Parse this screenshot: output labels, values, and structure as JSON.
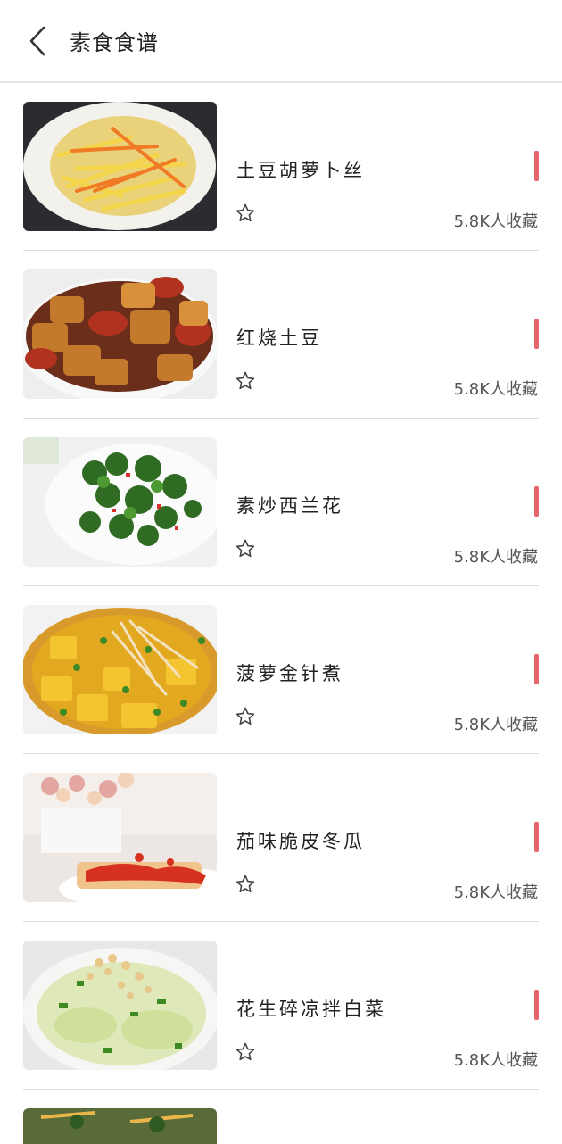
{
  "header": {
    "title": "素食食谱"
  },
  "recipes": [
    {
      "name": "土豆胡萝卜丝",
      "count": "5.8K人收藏"
    },
    {
      "name": "红烧土豆",
      "count": "5.8K人收藏"
    },
    {
      "name": "素炒西兰花",
      "count": "5.8K人收藏"
    },
    {
      "name": "菠萝金针煮",
      "count": "5.8K人收藏"
    },
    {
      "name": "茄味脆皮冬瓜",
      "count": "5.8K人收藏"
    },
    {
      "name": "花生碎凉拌白菜",
      "count": "5.8K人收藏"
    }
  ],
  "colors": {
    "accent": "#e8646b",
    "divider": "#dcdcdc"
  },
  "icons": {
    "back": "chevron-left-icon",
    "favorite": "star-outline-icon"
  }
}
